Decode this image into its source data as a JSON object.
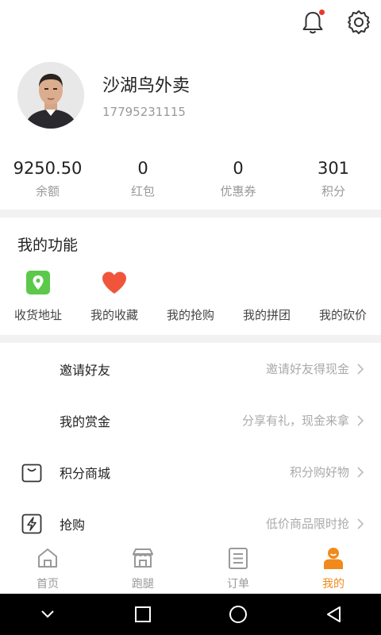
{
  "header": {
    "bell_icon": "bell-icon",
    "settings_icon": "gear-icon",
    "notification_dot_color": "#e8392b"
  },
  "profile": {
    "name": "沙湖鸟外卖",
    "phone": "17795231115"
  },
  "stats": [
    {
      "value": "9250.50",
      "label": "余额"
    },
    {
      "value": "0",
      "label": "红包"
    },
    {
      "value": "0",
      "label": "优惠券"
    },
    {
      "value": "301",
      "label": "积分"
    }
  ],
  "functions": {
    "title": "我的功能",
    "items": [
      {
        "label": "收货地址",
        "icon": "location-icon"
      },
      {
        "label": "我的收藏",
        "icon": "heart-icon"
      },
      {
        "label": "我的抢购",
        "icon": ""
      },
      {
        "label": "我的拼团",
        "icon": ""
      },
      {
        "label": "我的砍价",
        "icon": ""
      }
    ]
  },
  "menu": [
    {
      "label": "邀请好友",
      "hint": "邀请好友得现金",
      "icon": ""
    },
    {
      "label": "我的赏金",
      "hint": "分享有礼，现金来拿",
      "icon": ""
    },
    {
      "label": "积分商城",
      "hint": "积分购好物",
      "icon": "shopping-bag-icon"
    },
    {
      "label": "抢购",
      "hint": "低价商品限时抢",
      "icon": "lightning-icon"
    }
  ],
  "tabs": [
    {
      "label": "首页",
      "icon": "home-icon",
      "active": false
    },
    {
      "label": "跑腿",
      "icon": "store-icon",
      "active": false
    },
    {
      "label": "订单",
      "icon": "order-list-icon",
      "active": false
    },
    {
      "label": "我的",
      "icon": "user-icon",
      "active": true
    }
  ],
  "colors": {
    "accent": "#f08a1c",
    "hint": "#aaaaaa",
    "divider": "#f2f2f2",
    "location_green": "#5cc94a",
    "heart_red": "#f0553c"
  },
  "system_nav": {
    "icons": [
      "chevron-down-icon",
      "square-icon",
      "circle-icon",
      "triangle-back-icon"
    ]
  }
}
